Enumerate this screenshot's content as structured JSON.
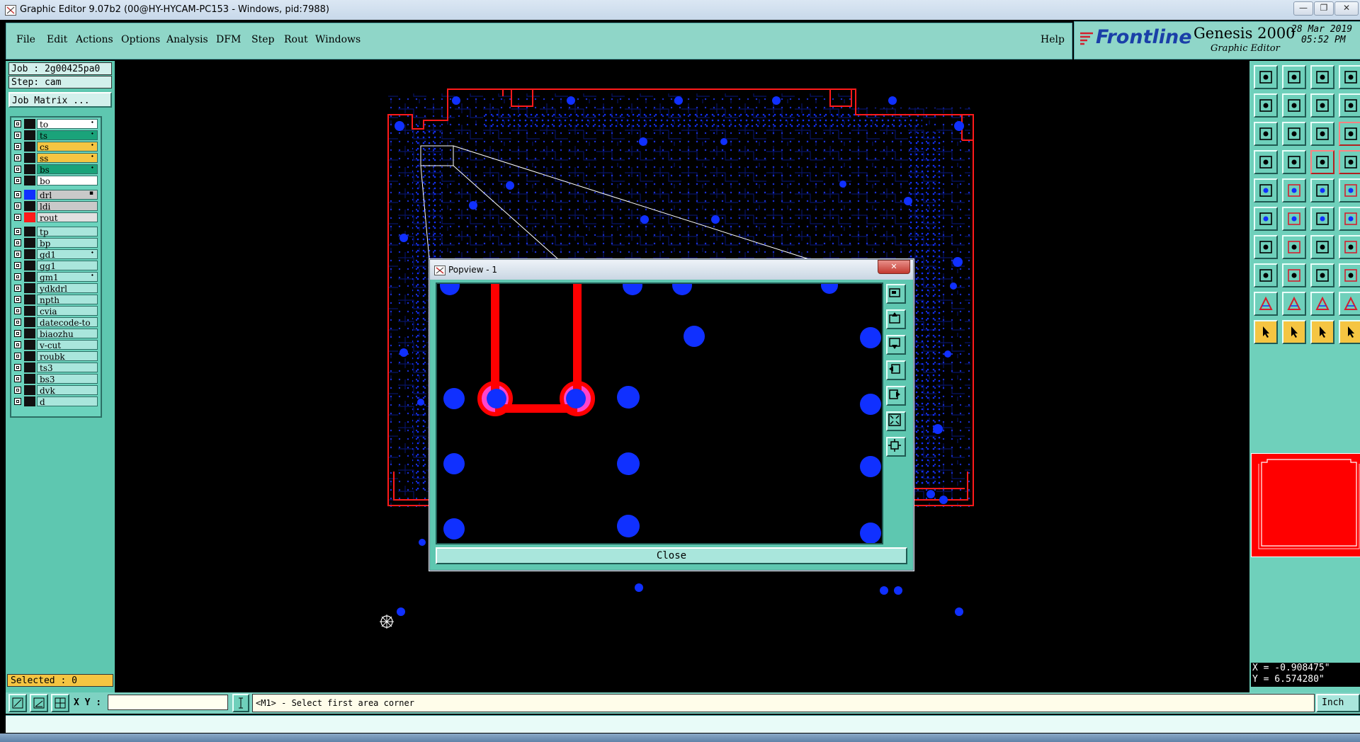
{
  "window": {
    "title": "Graphic Editor 9.07b2 (00@HY-HYCAM-PC153 - Windows, pid:7988)",
    "minimize": "—",
    "restore": "❐",
    "close": "✕"
  },
  "menu": {
    "items": [
      "File",
      "Edit",
      "Actions",
      "Options",
      "Analysis",
      "DFM",
      "Step",
      "Rout",
      "Windows"
    ],
    "help": "Help"
  },
  "brand": {
    "logo": "Frontline",
    "product": "Genesis 2000",
    "subtitle": "Graphic Editor",
    "date": "28 Mar 2019",
    "time": "05:52 PM"
  },
  "job": {
    "job_label": "Job : 2g00425pa0",
    "step_label": "Step: cam",
    "matrix_button": "Job Matrix ..."
  },
  "layers": [
    {
      "name": "to",
      "color": "#ffffff",
      "swatch": "#111111",
      "flag": "⬩"
    },
    {
      "name": "ts",
      "color": "#1aa37a",
      "swatch": "#111111",
      "flag": "⬩"
    },
    {
      "name": "cs",
      "color": "#f5c542",
      "swatch": "#111111",
      "flag": "⬩"
    },
    {
      "name": "ss",
      "color": "#f5c542",
      "swatch": "#111111",
      "flag": "⬩"
    },
    {
      "name": "bs",
      "color": "#1aa37a",
      "swatch": "#111111",
      "flag": "⬩"
    },
    {
      "name": "bo",
      "color": "#ffffff",
      "swatch": "#111111",
      "flag": ""
    },
    {
      "name": "drl",
      "color": "#c9c9c9",
      "swatch": "#1030ff",
      "flag": "▪"
    },
    {
      "name": "ldi",
      "color": "#c9c9c9",
      "swatch": "#111111",
      "flag": ""
    },
    {
      "name": "rout",
      "color": "#e0e0e0",
      "swatch": "#ff1a1a",
      "flag": ""
    },
    {
      "name": "tp",
      "color": "#a9e6dc",
      "swatch": "#111111",
      "flag": ""
    },
    {
      "name": "bp",
      "color": "#a9e6dc",
      "swatch": "#111111",
      "flag": ""
    },
    {
      "name": "gd1",
      "color": "#a9e6dc",
      "swatch": "#111111",
      "flag": "⬩"
    },
    {
      "name": "gg1",
      "color": "#a9e6dc",
      "swatch": "#111111",
      "flag": ""
    },
    {
      "name": "gm1",
      "color": "#a9e6dc",
      "swatch": "#111111",
      "flag": "⬩"
    },
    {
      "name": "ydkdrl",
      "color": "#a9e6dc",
      "swatch": "#111111",
      "flag": ""
    },
    {
      "name": "npth",
      "color": "#a9e6dc",
      "swatch": "#111111",
      "flag": ""
    },
    {
      "name": "cvia",
      "color": "#a9e6dc",
      "swatch": "#111111",
      "flag": ""
    },
    {
      "name": "datecode-to",
      "color": "#a9e6dc",
      "swatch": "#111111",
      "flag": ""
    },
    {
      "name": "biaozhu",
      "color": "#a9e6dc",
      "swatch": "#111111",
      "flag": ""
    },
    {
      "name": "v-cut",
      "color": "#a9e6dc",
      "swatch": "#111111",
      "flag": ""
    },
    {
      "name": "roubk",
      "color": "#a9e6dc",
      "swatch": "#111111",
      "flag": ""
    },
    {
      "name": "ts3",
      "color": "#a9e6dc",
      "swatch": "#111111",
      "flag": ""
    },
    {
      "name": "bs3",
      "color": "#a9e6dc",
      "swatch": "#111111",
      "flag": ""
    },
    {
      "name": "dvk",
      "color": "#a9e6dc",
      "swatch": "#111111",
      "flag": ""
    },
    {
      "name": "d",
      "color": "#a9e6dc",
      "swatch": "#111111",
      "flag": ""
    }
  ],
  "selected": "Selected : 0",
  "popview": {
    "title": "Popview - 1",
    "close_button": "Close",
    "close_x": "✕"
  },
  "coords": {
    "x": "X = -0.908475\"",
    "y": "Y = 6.574280\""
  },
  "bottom": {
    "xy_label": "X Y :",
    "xy_value": "",
    "prompt": "<M1> - Select first area corner",
    "units": "Inch"
  },
  "colors": {
    "panel": "#5ec7b0",
    "drill": "#1030ff",
    "rout": "#ff1a1a",
    "selected_bg": "#f5c542"
  }
}
